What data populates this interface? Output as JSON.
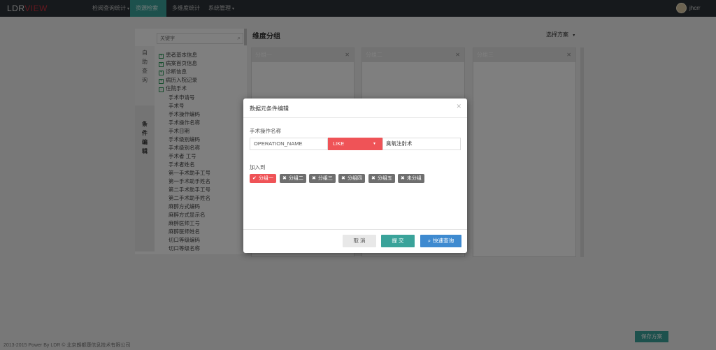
{
  "app": {
    "logo_part1": "LDR",
    "logo_part2": "VIEW"
  },
  "nav": {
    "items": [
      {
        "label": "检阅查询统计"
      },
      {
        "label": "资源检索"
      },
      {
        "label": "多维度统计"
      },
      {
        "label": "系统管理"
      }
    ],
    "user": "jhcrr"
  },
  "sidebar": {
    "tab_a": "自助查询",
    "tab_b": "条件编辑",
    "search_placeholder": "关键字",
    "tree": [
      {
        "label": "患者基本信息",
        "sign": "+"
      },
      {
        "label": "病案首页信息",
        "sign": "+"
      },
      {
        "label": "诊断信息",
        "sign": "+"
      },
      {
        "label": "病历入院记录",
        "sign": "+"
      },
      {
        "label": "住院手术",
        "sign": "-"
      }
    ],
    "leaves": [
      "手术申请号",
      "手术号",
      "手术操作编码",
      "手术操作名称",
      "手术日期",
      "手术级别编码",
      "手术级别名称",
      "手术者 工号",
      "手术者姓名",
      "第一手术助手工号",
      "第一手术助手姓名",
      "第二手术助手工号",
      "第二手术助手姓名",
      "麻醉方式编码",
      "麻醉方式显示名",
      "麻醉医师工号",
      "麻醉医师姓名",
      "切口等级编码",
      "切口等级名称"
    ]
  },
  "main": {
    "title": "维度分组",
    "scheme_select": "选择方案",
    "groups": [
      {
        "label": "分组一"
      },
      {
        "label": "分组二"
      },
      {
        "label": "分组三"
      }
    ],
    "save_scheme": "保存方案"
  },
  "footer": {
    "text": "2013-2015 Power By LDR © 北京朗都康信息技术有限公司"
  },
  "modal": {
    "title": "数据元条件编辑",
    "field_label": "手术操作名称",
    "field_code": "OPERATION_NAME",
    "operator": "LIKE",
    "value": "臭氧注射术",
    "add_to_label": "加入到",
    "chips": [
      {
        "label": "分组一",
        "selected": true
      },
      {
        "label": "分组二",
        "selected": false
      },
      {
        "label": "分组三",
        "selected": false
      },
      {
        "label": "分组四",
        "selected": false
      },
      {
        "label": "分组五",
        "selected": false
      },
      {
        "label": "未分组",
        "selected": false
      }
    ],
    "cancel": "取 消",
    "submit": "提 交",
    "quick_query": "快速查询"
  },
  "colors": {
    "accent_teal": "#3aa39a",
    "danger_red": "#ef5357",
    "primary_blue": "#3e8ad0",
    "nav_dark": "#2c3338"
  }
}
